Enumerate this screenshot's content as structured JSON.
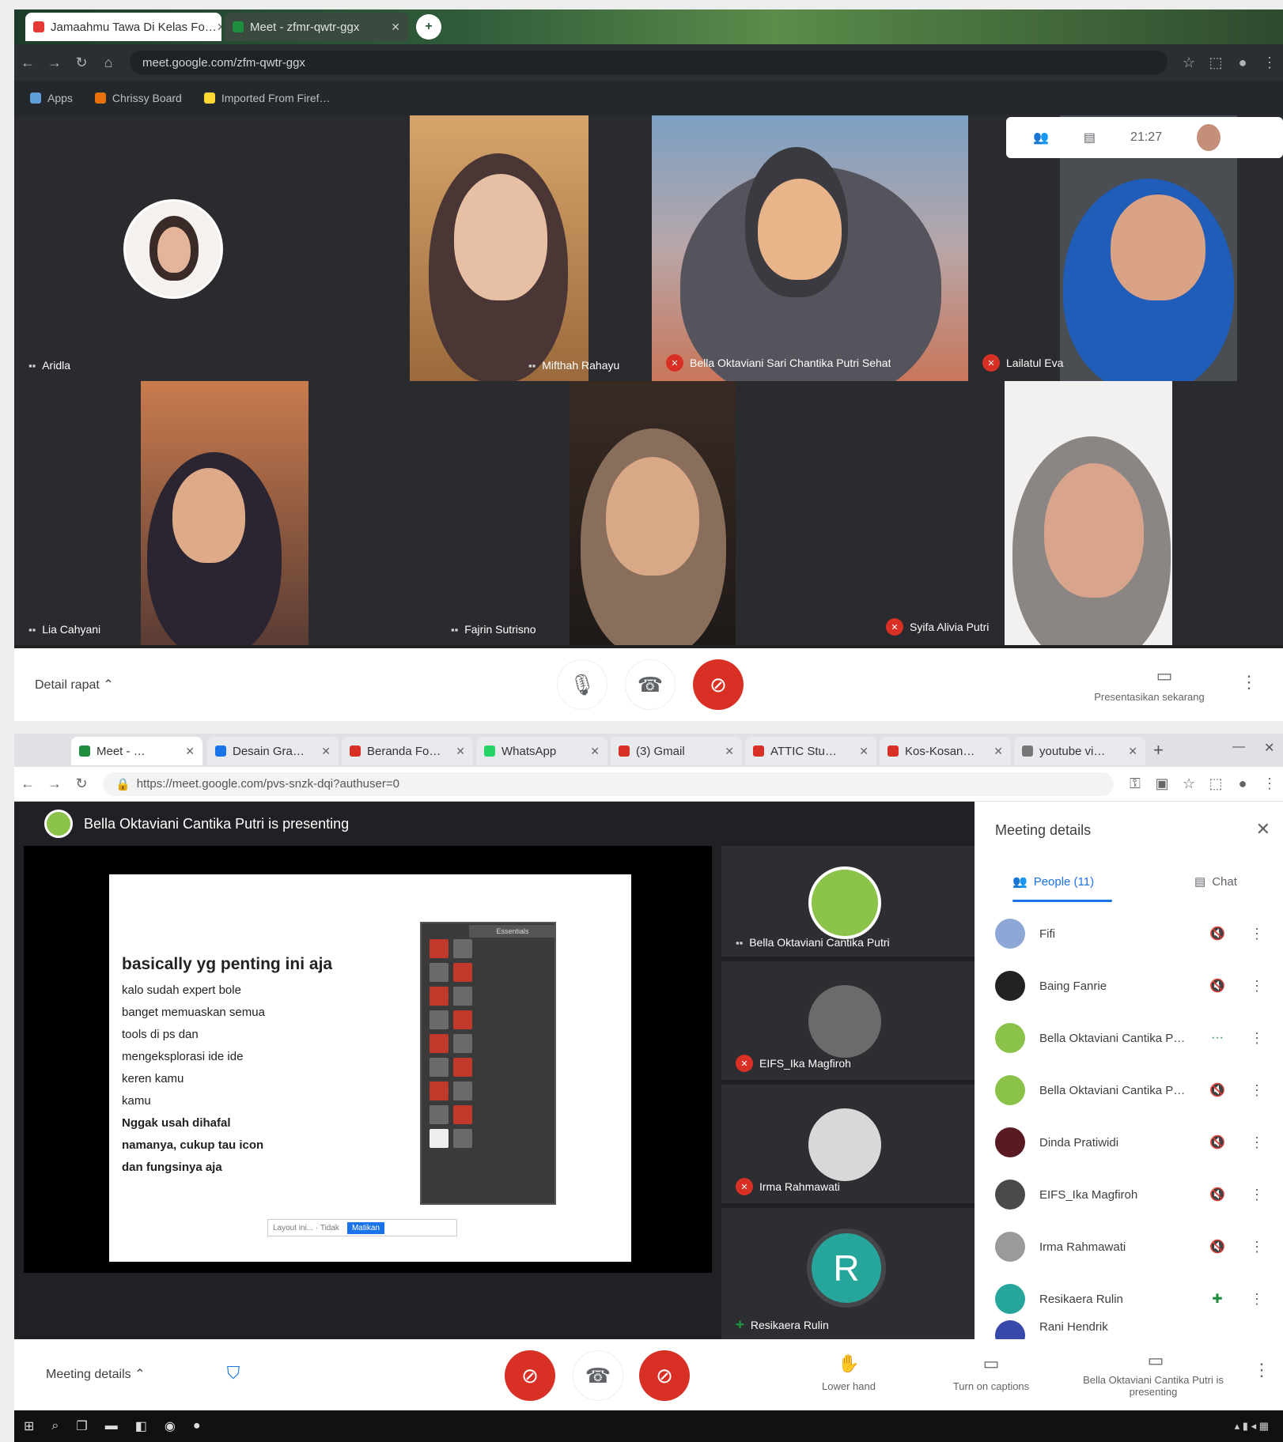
{
  "top": {
    "tabs": [
      {
        "title": "Jamaahmu Tawa Di Kelas Fo…",
        "color": "#e53935"
      },
      {
        "title": "Meet - zfmr-qwtr-ggx",
        "color": "#1e8e3e"
      }
    ],
    "url": "meet.google.com/zfm-qwtr-ggx",
    "bookmarks": [
      {
        "label": "Apps",
        "color": "#5f9dd6"
      },
      {
        "label": "Chrissy Board",
        "color": "#e8710a"
      },
      {
        "label": "Imported From Firef…",
        "color": "#fdd835"
      }
    ],
    "participants": [
      {
        "name": "Aridla",
        "muted": false
      },
      {
        "name": "Mifthah Rahayu",
        "muted": false
      },
      {
        "name": "Bella Oktaviani Sari Chantika Putri Sehat",
        "muted": true
      },
      {
        "name": "Lailatul Eva",
        "muted": true
      },
      {
        "name": "Lia Cahyani",
        "muted": false
      },
      {
        "name": "Fajrin Sutrisno",
        "muted": false
      },
      {
        "name": "Syifa Alivia Putri",
        "muted": true
      }
    ],
    "clock": "21:27",
    "meeting_details": "Detail rapat",
    "present_now": "Presentasikan sekarang",
    "icons": {
      "mic": "mic-icon",
      "end": "hangup-icon",
      "cam": "camera-off-icon",
      "more": "more-icon"
    }
  },
  "bottom": {
    "tabs": [
      {
        "title": "Meet - …",
        "color": "#1e8e3e"
      },
      {
        "title": "Desain Gra…",
        "color": "#1a73e8"
      },
      {
        "title": "Beranda Fo…",
        "color": "#d93025"
      },
      {
        "title": "WhatsApp",
        "color": "#25d366"
      },
      {
        "title": "(3) Gmail",
        "color": "#d93025"
      },
      {
        "title": "ATTIC Stu…",
        "color": "#d93025"
      },
      {
        "title": "Kos-Kosan…",
        "color": "#d93025"
      },
      {
        "title": "youtube vi…",
        "color": "#777777"
      }
    ],
    "url": "https://meet.google.com/pvs-snzk-dqi?authuser=0",
    "presenting_text": "Bella Oktaviani Cantika Putri is presenting",
    "slide": {
      "title": "basically yg penting ini aja",
      "lines": [
        {
          "text": "kalo sudah expert bole",
          "bold": false
        },
        {
          "text": "banget memuaskan semua",
          "bold": false
        },
        {
          "text": "tools di ps dan",
          "bold": false
        },
        {
          "text": "mengeksplorasi ide ide",
          "bold": false
        },
        {
          "text": "keren kamu",
          "bold": false
        },
        {
          "text": "kamu",
          "bold": false
        },
        {
          "text": "Nggak usah dihafal",
          "bold": true
        },
        {
          "text": "namanya, cukup tau icon",
          "bold": true
        },
        {
          "text": "dan fungsinya aja",
          "bold": true
        }
      ],
      "toolbox_header": "Essentials",
      "search_hint": "Layout ini... · Tidak",
      "search_button": "Matikan"
    },
    "side_tiles": [
      {
        "name": "Bella Oktaviani Cantika Putri",
        "muted": false
      },
      {
        "name": "EIFS_Ika Magfiroh",
        "muted": true
      },
      {
        "name": "Irma Rahmawati",
        "muted": true
      },
      {
        "name": "Resikaera Rulin",
        "muted": false,
        "initial": "R"
      }
    ],
    "panel": {
      "title": "Meeting details",
      "tab_people": "People (11)",
      "tab_chat": "Chat",
      "people": [
        {
          "name": "Fifi",
          "color": "#8fa7d6"
        },
        {
          "name": "Baing Fanrie",
          "color": "#222222"
        },
        {
          "name": "Bella Oktaviani Cantika Putri",
          "color": "#8bc34a"
        },
        {
          "name": "Bella Oktaviani Cantika Putri",
          "color": "#8bc34a"
        },
        {
          "name": "Dinda Pratiwidi",
          "color": "#5a1a22"
        },
        {
          "name": "EIFS_Ika Magfiroh",
          "color": "#4a4a4a"
        },
        {
          "name": "Irma Rahmawati",
          "color": "#9a9a9a"
        },
        {
          "name": "Resikaera Rulin",
          "color": "#26a69a"
        },
        {
          "name": "Rani Hendrik",
          "color": "#3949ab"
        }
      ]
    },
    "meeting_details": "Meeting details",
    "raise_hand": "Lower hand",
    "captions": "Turn on captions",
    "presenting": "Bella Oktaviani Cantika Putri is presenting"
  }
}
